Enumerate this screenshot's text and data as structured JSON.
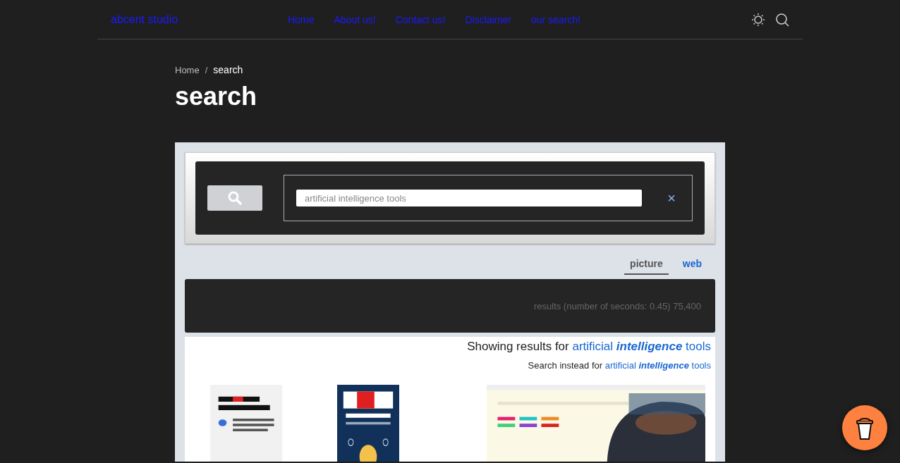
{
  "header": {
    "brand": "abcent studio",
    "nav": [
      {
        "label": "Home"
      },
      {
        "label": "About us!"
      },
      {
        "label": "Contact us!"
      },
      {
        "label": "Disclaimer"
      },
      {
        "label": "our search!"
      }
    ]
  },
  "breadcrumb_separator": "/",
  "breadcrumb": [
    {
      "label": "Home",
      "current": false
    },
    {
      "label": "search",
      "current": true
    }
  ],
  "page_title": "search",
  "search": {
    "value": "artificial intelligence tools",
    "clear": "×"
  },
  "tabs": [
    {
      "label": "picture",
      "selected": true
    },
    {
      "label": "web",
      "selected": false
    }
  ],
  "results_info": "results (number of seconds: 0.45) 75,400",
  "showing": {
    "prefix": "Showing results for",
    "query": "artificial **intelligence** tools"
  },
  "instead": {
    "prefix": "Search instead for",
    "query": "artificial **intelligence** tools"
  }
}
